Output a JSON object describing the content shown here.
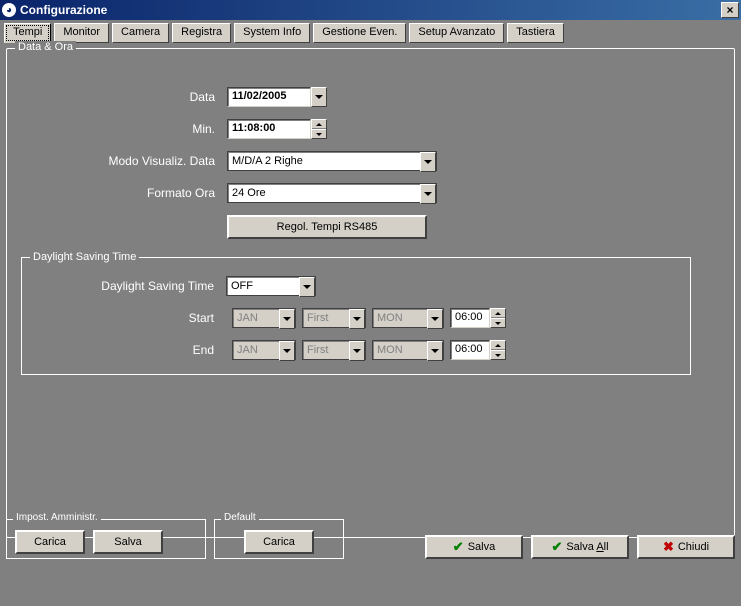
{
  "window": {
    "title": "Configurazione",
    "close": "×"
  },
  "tabs": {
    "tempi": "Tempi",
    "monitor": "Monitor",
    "camera": "Camera",
    "registra": "Registra",
    "sysinfo": "System Info",
    "gestione": "Gestione Even.",
    "setup": "Setup Avanzato",
    "tastiera": "Tastiera"
  },
  "dataora": {
    "legend": "Data & Ora",
    "data_label": "Data",
    "data_value": "11/02/2005",
    "min_label": "Min.",
    "min_value": "11:08:00",
    "mode_label": "Modo Visualiz. Data",
    "mode_value": "M/D/A 2 Righe",
    "format_label": "Formato Ora",
    "format_value": "24 Ore",
    "rs485_btn": "Regol. Tempi RS485"
  },
  "dst": {
    "legend": "Daylight Saving Time",
    "dst_label": "Daylight Saving Time",
    "dst_value": "OFF",
    "start_label": "Start",
    "end_label": "End",
    "month": "JAN",
    "week": "First",
    "day": "MON",
    "time": "06:00"
  },
  "admin": {
    "legend": "Impost. Amministr.",
    "carica": "Carica",
    "salva": "Salva"
  },
  "default": {
    "legend": "Default",
    "carica": "Carica"
  },
  "footer": {
    "salva": "Salva",
    "salva_all_prefix": "Salva ",
    "salva_all_u": "A",
    "salva_all_suffix": "ll",
    "chiudi": "Chiudi"
  }
}
